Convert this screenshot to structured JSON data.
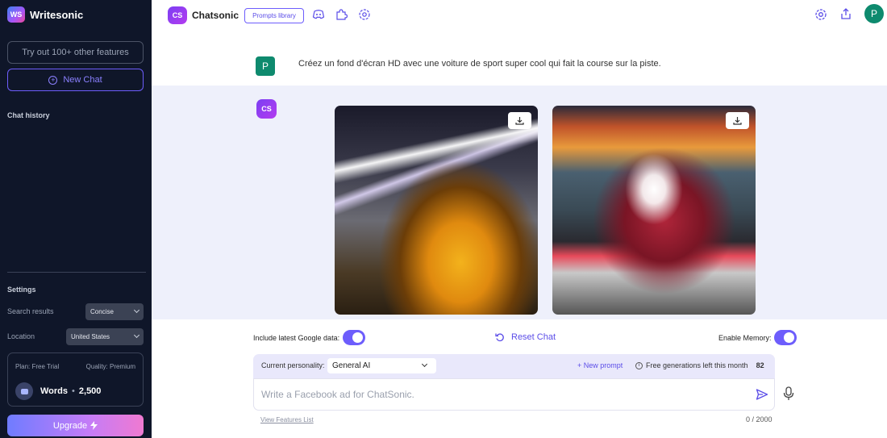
{
  "sidebar": {
    "brand_logo": "WS",
    "brand_name": "Writesonic",
    "try_features": "Try out 100+ other features",
    "new_chat": "New Chat",
    "chat_history_title": "Chat history",
    "settings_title": "Settings",
    "search_results_label": "Search results",
    "search_results_value": "Concise",
    "location_label": "Location",
    "location_value": "United States",
    "plan": "Plan: Free Trial",
    "quality": "Quality: Premium",
    "words_label": "Words",
    "words_separator": "•",
    "words_count": "2,500",
    "upgrade": "Upgrade"
  },
  "topbar": {
    "logo": "CS",
    "title": "Chatsonic",
    "prompts_library": "Prompts library",
    "avatar_initial": "P"
  },
  "conversation": {
    "user_initial": "P",
    "user_message": "Créez un fond d'écran HD avec une voiture de sport super cool qui fait la course sur la piste.",
    "bot_logo": "CS"
  },
  "controls": {
    "include_google_label": "Include latest Google data:",
    "include_google_on": true,
    "reset_chat": "Reset Chat",
    "enable_memory_label": "Enable Memory:",
    "enable_memory_on": true
  },
  "prompt": {
    "personality_label": "Current personality:",
    "personality_value": "General AI",
    "new_prompt": "+ New prompt",
    "free_generations_label": "Free generations left this month",
    "free_generations_count": "82",
    "placeholder": "Write a Facebook ad for ChatSonic.",
    "view_features": "View Features List",
    "char_count": "0 / 2000"
  },
  "colors": {
    "sidebar_bg": "#0f1629",
    "accent": "#6d5dfc",
    "bot_area_bg": "#eef0fb",
    "avatar_green": "#0e8a6e"
  },
  "icons": [
    "discord-icon",
    "puzzle-icon",
    "gear-badge-icon",
    "settings-icon",
    "share-icon",
    "download-icon",
    "reset-icon",
    "send-icon",
    "mic-icon",
    "lightning-icon"
  ]
}
